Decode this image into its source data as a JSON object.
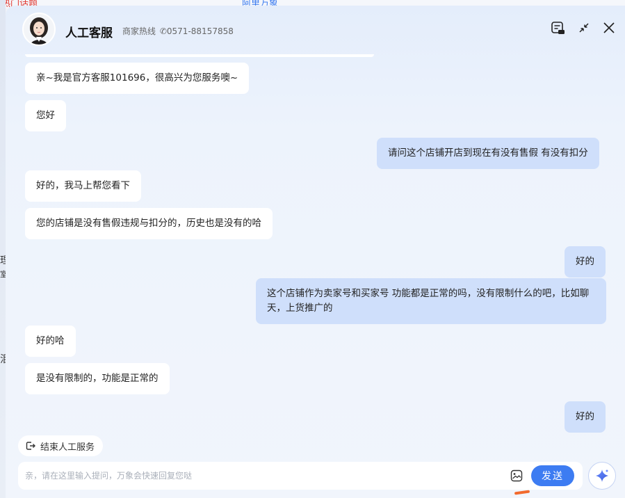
{
  "background": {
    "title_left": "热门话题",
    "title_right": "阿里万象",
    "side_chars": [
      "理",
      "室",
      "泪"
    ]
  },
  "header": {
    "title": "人工客服",
    "hotline_label": "商家热线",
    "hotline_number": "0571-88157858"
  },
  "messages": [
    {
      "side": "left",
      "text": "亲~我是官方客服101696，很高兴为您服务噢~"
    },
    {
      "side": "left",
      "text": "您好"
    },
    {
      "side": "right",
      "text": "请问这个店铺开店到现在有没有售假 有没有扣分"
    },
    {
      "side": "left",
      "text": "好的，我马上帮您看下"
    },
    {
      "side": "left",
      "text": "您的店铺是没有售假违规与扣分的，历史也是没有的哈"
    },
    {
      "side": "right",
      "text": "好的"
    },
    {
      "side": "right",
      "text": "这个店铺作为卖家号和买家号 功能都是正常的吗，没有限制什么的吧，比如聊天，上货推广的"
    },
    {
      "side": "left",
      "text": "好的哈"
    },
    {
      "side": "left",
      "text": "是没有限制的，功能是正常的"
    },
    {
      "side": "right",
      "text": "好的"
    }
  ],
  "footer": {
    "end_service_label": "结束人工服务",
    "input_placeholder": "亲，请在这里输入提问，万象会快速回复您哒",
    "send_label": "发送"
  },
  "colors": {
    "accent": "#3d7cf2",
    "user_bubble": "#cfdffb",
    "agent_bubble": "#ffffff"
  }
}
